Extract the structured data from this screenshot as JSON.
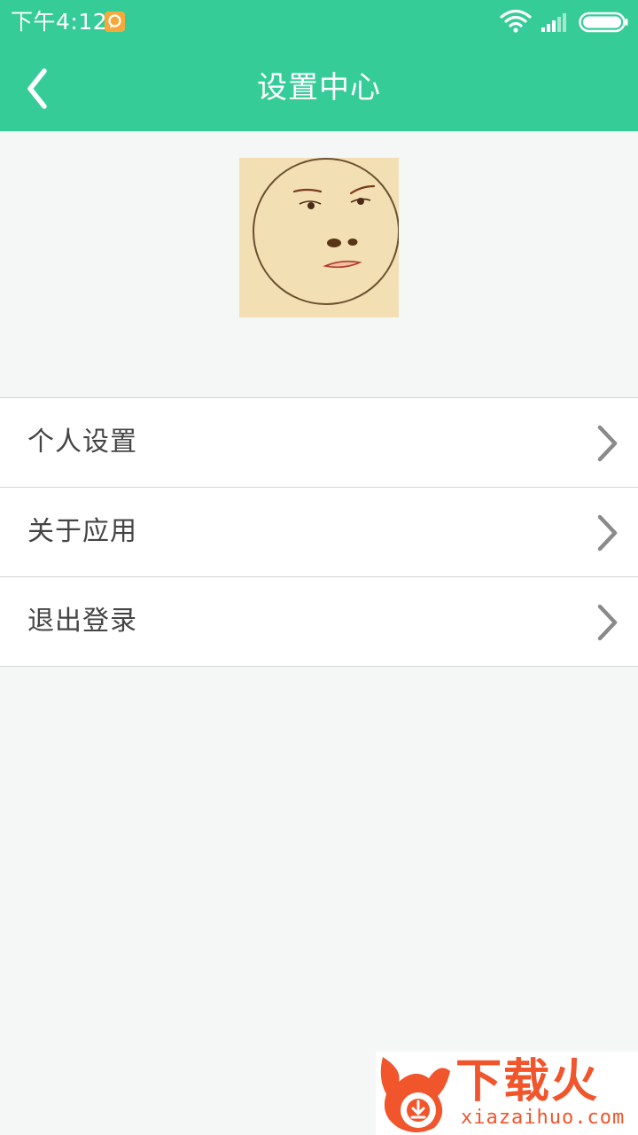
{
  "status_bar": {
    "time": "下午4:12"
  },
  "header": {
    "title": "设置中心"
  },
  "menu": {
    "items": [
      {
        "label": "个人设置"
      },
      {
        "label": "关于应用"
      },
      {
        "label": "退出登录"
      }
    ]
  },
  "watermark": {
    "brand": "下载火",
    "url": "xiazaihuo.com"
  },
  "colors": {
    "accent": "#36cc98",
    "background": "#f5f6f6",
    "watermark": "#f0552b"
  },
  "icons": {
    "back": "chevron-left-icon",
    "item_arrow": "chevron-right-icon",
    "wifi": "wifi-icon",
    "signal": "signal-icon",
    "battery": "battery-icon",
    "notification": "message-notification-icon"
  }
}
